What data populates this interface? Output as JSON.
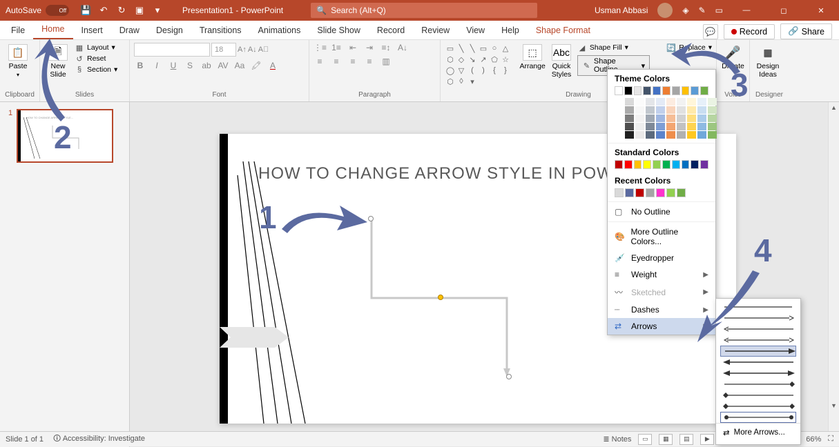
{
  "titlebar": {
    "autosave": "AutoSave",
    "autosave_state": "Off",
    "title": "Presentation1 - PowerPoint",
    "search_placeholder": "Search (Alt+Q)",
    "user": "Usman Abbasi"
  },
  "tabs": {
    "file": "File",
    "home": "Home",
    "insert": "Insert",
    "draw": "Draw",
    "design": "Design",
    "transitions": "Transitions",
    "animations": "Animations",
    "slideshow": "Slide Show",
    "record": "Record",
    "review": "Review",
    "view": "View",
    "help": "Help",
    "shapeformat": "Shape Format",
    "record_btn": "Record",
    "share": "Share"
  },
  "ribbon": {
    "clipboard": {
      "label": "Clipboard",
      "paste": "Paste"
    },
    "slides": {
      "label": "Slides",
      "newslide": "New\nSlide",
      "layout": "Layout",
      "reset": "Reset",
      "section": "Section"
    },
    "font": {
      "label": "Font",
      "size": "18"
    },
    "paragraph": {
      "label": "Paragraph"
    },
    "drawing": {
      "label": "Drawing",
      "arrange": "Arrange",
      "quickstyles": "Quick\nStyles",
      "shapefill": "Shape Fill",
      "shapeoutline": "Shape Outline"
    },
    "editing": {
      "replace": "Replace"
    },
    "voice": {
      "label": "Voice",
      "dictate": "Dictate"
    },
    "designer": {
      "label": "Designer",
      "ideas": "Design\nIdeas"
    }
  },
  "slidepanel": {
    "num": "1"
  },
  "slide": {
    "title": "HOW TO CHANGE ARROW  STYLE IN POWERPOINT"
  },
  "dropdown": {
    "theme_colors": "Theme Colors",
    "standard_colors": "Standard Colors",
    "recent_colors": "Recent Colors",
    "no_outline": "No Outline",
    "more_colors": "More Outline Colors...",
    "eyedropper": "Eyedropper",
    "weight": "Weight",
    "sketched": "Sketched",
    "dashes": "Dashes",
    "arrows": "Arrows",
    "theme_row": [
      "#ffffff",
      "#000000",
      "#e7e6e6",
      "#44546a",
      "#4472c4",
      "#ed7d31",
      "#a5a5a5",
      "#ffc000",
      "#5b9bd5",
      "#70ad47"
    ],
    "standard_row": [
      "#c00000",
      "#ff0000",
      "#ffc000",
      "#ffff00",
      "#92d050",
      "#00b050",
      "#00b0f0",
      "#0070c0",
      "#002060",
      "#7030a0"
    ],
    "recent_row": [
      "#d9d9d9",
      "#5b6aa0",
      "#c00000",
      "#a5a5a5",
      "#ff33cc",
      "#92d050",
      "#70ad47"
    ]
  },
  "submenu": {
    "more_arrows": "More Arrows..."
  },
  "status": {
    "slide": "Slide 1 of 1",
    "accessibility": "Accessibility: Investigate",
    "notes": "Notes",
    "zoom": "66%"
  },
  "annotations": {
    "n1": "1",
    "n2": "2",
    "n3": "3",
    "n4": "4"
  }
}
